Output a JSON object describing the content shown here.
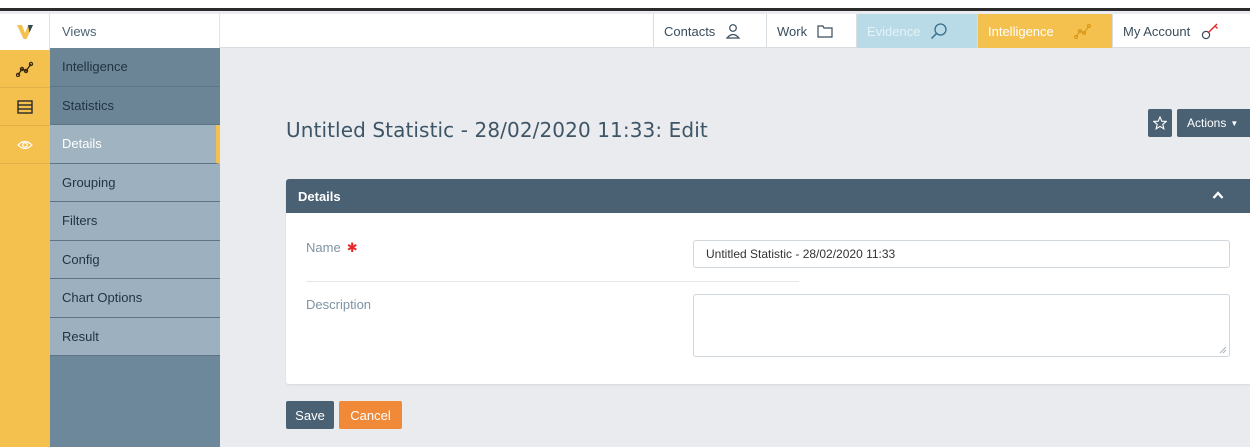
{
  "app": {
    "logo_letter": "V"
  },
  "sidebar": {
    "views_label": "Views",
    "items": [
      {
        "label": "Intelligence"
      },
      {
        "label": "Statistics"
      },
      {
        "label": "Details"
      },
      {
        "label": "Grouping"
      },
      {
        "label": "Filters"
      },
      {
        "label": "Config"
      },
      {
        "label": "Chart Options"
      },
      {
        "label": "Result"
      }
    ]
  },
  "topnav": {
    "contacts": "Contacts",
    "work": "Work",
    "evidence": "Evidence",
    "intelligence": "Intelligence",
    "my_account": "My Account"
  },
  "main": {
    "title": "Untitled Statistic - 28/02/2020 11:33: Edit",
    "actions_label": "Actions",
    "panel_title": "Details",
    "name_label": "Name",
    "required_mark": "✱",
    "name_value": "Untitled Statistic - 28/02/2020 11:33",
    "description_label": "Description",
    "description_value": "",
    "save_label": "Save",
    "cancel_label": "Cancel"
  },
  "colors": {
    "accent_yellow": "#f4c14e",
    "header_slate": "#4a6174",
    "cancel_orange": "#f08a39",
    "required_red": "#e8292b"
  }
}
